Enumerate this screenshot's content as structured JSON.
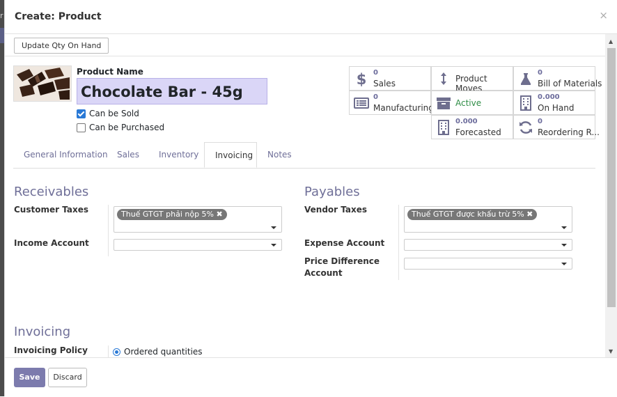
{
  "background": {
    "left_strip_char": "r"
  },
  "dialog": {
    "title": "Create: Product",
    "close_symbol": "×"
  },
  "toolbar": {
    "update_qty": "Update Qty On Hand"
  },
  "product": {
    "name_label": "Product Name",
    "name_value": "Chocolate Bar - 45g",
    "can_be_sold_label": "Can be Sold",
    "can_be_sold": true,
    "can_be_purchased_label": "Can be Purchased",
    "can_be_purchased": false
  },
  "smart_buttons": [
    {
      "icon": "dollar-icon",
      "number": "0",
      "label": "Sales"
    },
    {
      "icon": "arrows-vertical-icon",
      "number": "",
      "label": "Product Moves"
    },
    {
      "icon": "flask-icon",
      "number": "0",
      "label": "Bill of Materials"
    },
    {
      "icon": "list-icon",
      "number": "0",
      "label": "Manufacturing"
    },
    {
      "icon": "archive-icon",
      "number": "",
      "label": "Active"
    },
    {
      "icon": "building-icon",
      "number": "0.000",
      "label": "On Hand"
    },
    {
      "icon": "building-icon",
      "number": "0.000",
      "label": "Forecasted"
    },
    {
      "icon": "refresh-icon",
      "number": "0",
      "label": "Reordering R..."
    }
  ],
  "tabs": [
    "General Information",
    "Sales",
    "Inventory",
    "Invoicing",
    "Notes"
  ],
  "active_tab": "Invoicing",
  "receivables": {
    "title": "Receivables",
    "customer_taxes_label": "Customer Taxes",
    "customer_tax_tag": "Thuế GTGT phải nộp 5%",
    "income_account_label": "Income Account",
    "income_account_value": ""
  },
  "payables": {
    "title": "Payables",
    "vendor_taxes_label": "Vendor Taxes",
    "vendor_tax_tag": "Thuế GTGT được khấu trừ 5%",
    "expense_account_label": "Expense Account",
    "expense_account_value": "",
    "price_diff_label_1": "Price Difference",
    "price_diff_label_2": "Account",
    "price_diff_value": ""
  },
  "invoicing": {
    "title": "Invoicing",
    "policy_label": "Invoicing Policy",
    "policy_value": "Ordered quantities"
  },
  "footer": {
    "save": "Save",
    "discard": "Discard"
  },
  "colors": {
    "accent": "#7c7bad",
    "tab_text": "#6f6f98",
    "input_highlight": "#dad6f7",
    "active_green": "#2f8d46"
  }
}
